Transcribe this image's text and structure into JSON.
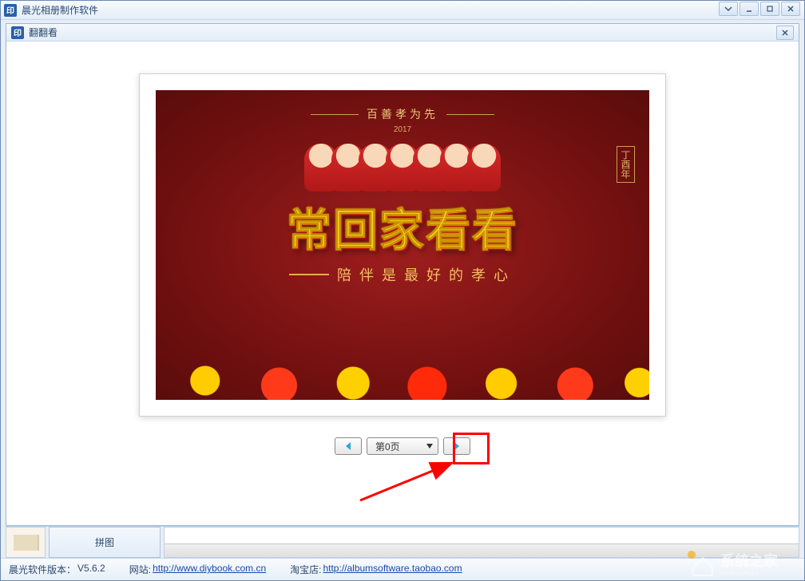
{
  "outer_window": {
    "title": "晨光相册制作软件",
    "icon_label": "印"
  },
  "inner_window": {
    "title": "翻翻看",
    "icon_label": "印"
  },
  "poster": {
    "top_text": "百善孝为先",
    "year": "2017",
    "side_text": "丁酉年",
    "main_text": "常回家看看",
    "sub_text": "陪伴是最好的孝心"
  },
  "navigation": {
    "page_label": "第0页"
  },
  "bottom": {
    "pintu_label": "拼图"
  },
  "status": {
    "version_label": "晨光软件版本：",
    "version_value": "V5.6.2",
    "website_label": "网站:",
    "website_url": "http://www.diybook.com.cn",
    "taobao_label": "淘宝店:",
    "taobao_url": "http://albumsoftware.taobao.com"
  },
  "watermark_text": "系统之家"
}
